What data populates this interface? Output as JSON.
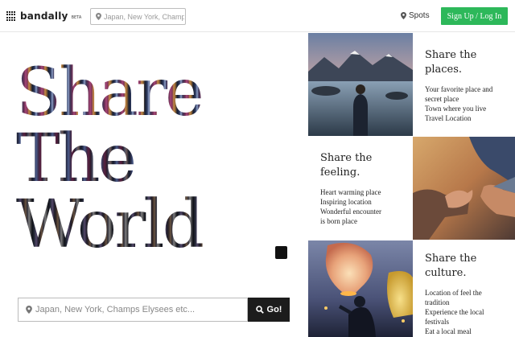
{
  "header": {
    "brand": "bandally",
    "beta": "BETA",
    "search_placeholder": "Japan, New York, Champs Elysees etc...",
    "spots_label": "Spots",
    "signup_label": "Sign Up / Log In"
  },
  "hero": {
    "line1": "Share",
    "line2": "The",
    "line3": "World",
    "search_placeholder": "Japan, New York, Champs Elysees etc...",
    "go_label": "Go!"
  },
  "tiles": [
    {
      "title_line1": "Share the",
      "title_line2": "places.",
      "items": [
        "Your favorite place and",
        "secret place",
        "Town where you live",
        "Travel Location"
      ]
    },
    {
      "title_line1": "Share the",
      "title_line2": "feeling.",
      "items": [
        "Heart warming place",
        "Inspiring location",
        "Wonderful encounter",
        "is born place"
      ]
    },
    {
      "title_line1": "Share the",
      "title_line2": "culture.",
      "items": [
        "Location of feel the",
        "tradition",
        "Experience the local",
        "festivals",
        "Eat a local meal"
      ]
    }
  ],
  "colors": {
    "accent_green": "#2db85a",
    "go_button": "#1c1c1c"
  }
}
